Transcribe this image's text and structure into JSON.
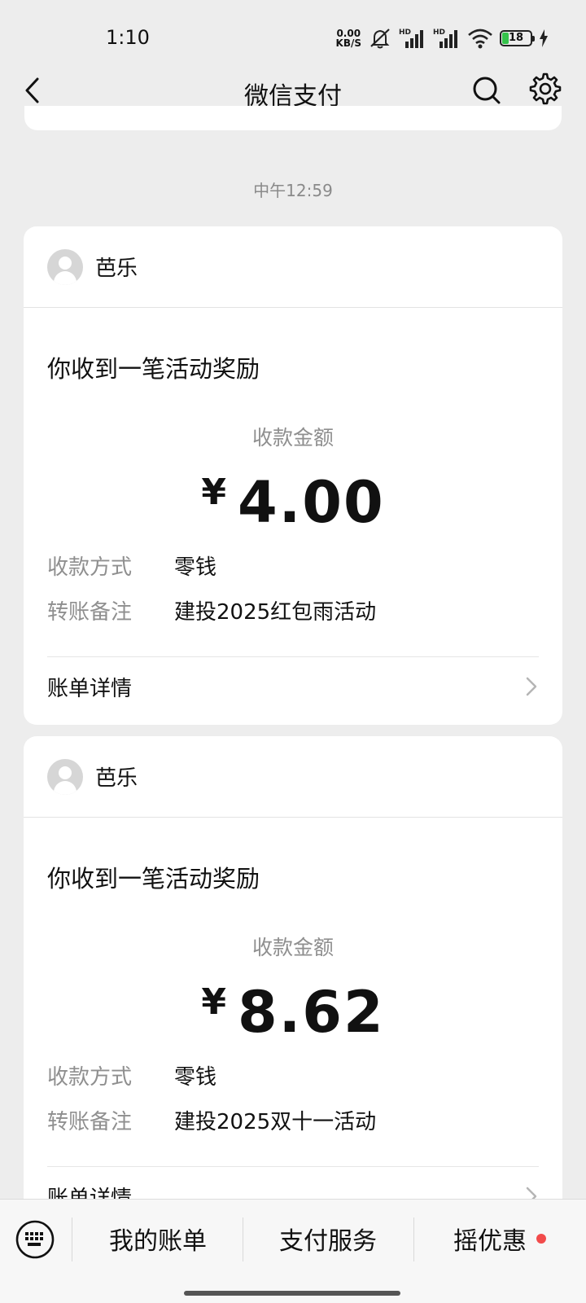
{
  "status_bar": {
    "time": "1:10",
    "net_speed_value": "0.00",
    "net_speed_unit": "KB/S",
    "battery_level": "18"
  },
  "nav": {
    "title": "微信支付"
  },
  "timestamp": "中午12:59",
  "cards": [
    {
      "sender": "芭乐",
      "title": "你收到一笔活动奖励",
      "amount_label": "收款金额",
      "currency": "¥",
      "amount": "4.00",
      "method_key": "收款方式",
      "method_val": "零钱",
      "note_key": "转账备注",
      "note_val": "建投2025红包雨活动",
      "detail_label": "账单详情"
    },
    {
      "sender": "芭乐",
      "title": "你收到一笔活动奖励",
      "amount_label": "收款金额",
      "currency": "¥",
      "amount": "8.62",
      "method_key": "收款方式",
      "method_val": "零钱",
      "note_key": "转账备注",
      "note_val": "建投2025双十一活动",
      "detail_label": "账单详情"
    }
  ],
  "bottom_menu": {
    "items": [
      "我的账单",
      "支付服务",
      "摇优惠"
    ]
  },
  "colors": {
    "background": "#ededed",
    "card": "#ffffff",
    "badge_dot": "#f24b4b",
    "battery_fill": "#35c24b"
  },
  "icons": [
    "back-icon",
    "search-icon",
    "gear-icon",
    "keyboard-icon",
    "chevron-right-icon",
    "avatar-icon"
  ]
}
